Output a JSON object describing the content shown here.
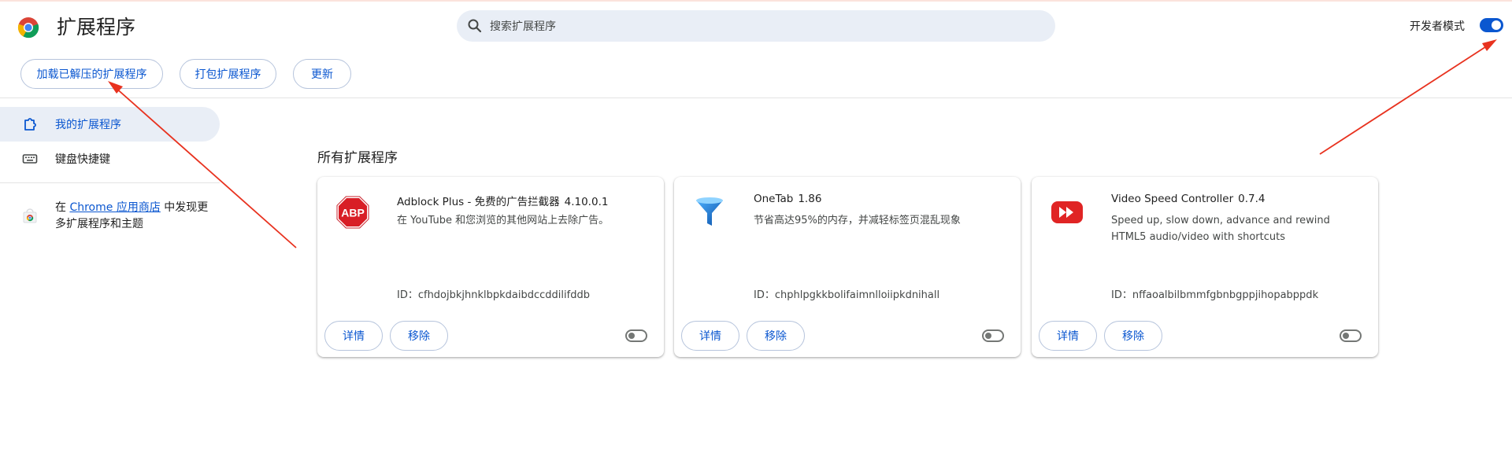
{
  "header": {
    "title": "扩展程序",
    "search_placeholder": "搜索扩展程序",
    "dev_mode_label": "开发者模式",
    "dev_mode_on": true
  },
  "toolbar": {
    "load_unpacked": "加载已解压的扩展程序",
    "pack_extension": "打包扩展程序",
    "update": "更新"
  },
  "sidebar": {
    "items": [
      {
        "label": "我的扩展程序",
        "icon": "puzzle-icon",
        "active": true
      },
      {
        "label": "键盘快捷键",
        "icon": "keyboard-icon",
        "active": false
      }
    ],
    "store": {
      "prefix": "在 ",
      "link": "Chrome 应用商店",
      "suffix": " 中发现更多扩展程序和主题"
    }
  },
  "main": {
    "section_title": "所有扩展程序",
    "extensions": [
      {
        "name": "Adblock Plus - 免费的广告拦截器",
        "version": "4.10.0.1",
        "description": "在 YouTube 和您浏览的其他网站上去除广告。",
        "id": "ID：cfhdojbkjhnklbpkdaibdccddilifddb",
        "icon": "abp-icon",
        "details_label": "详情",
        "remove_label": "移除",
        "enabled": false
      },
      {
        "name": "OneTab",
        "version": "1.86",
        "description": "节省高达95%的内存，并减轻标签页混乱现象",
        "id": "ID：chphlpgkkbolifaimnlloiipkdnihall",
        "icon": "onetab-funnel-icon",
        "details_label": "详情",
        "remove_label": "移除",
        "enabled": false
      },
      {
        "name": "Video Speed Controller",
        "version": "0.7.4",
        "description": "Speed up, slow down, advance and rewind HTML5 audio/video with shortcuts",
        "id": "ID：nffaoalbilbmmfgbnbgppjihopabppdk",
        "icon": "fast-forward-icon",
        "details_label": "详情",
        "remove_label": "移除",
        "enabled": false
      }
    ]
  },
  "colors": {
    "accent": "#0b57d0",
    "annotation_arrow": "#e8321f",
    "active_bg": "#e9eef6"
  }
}
